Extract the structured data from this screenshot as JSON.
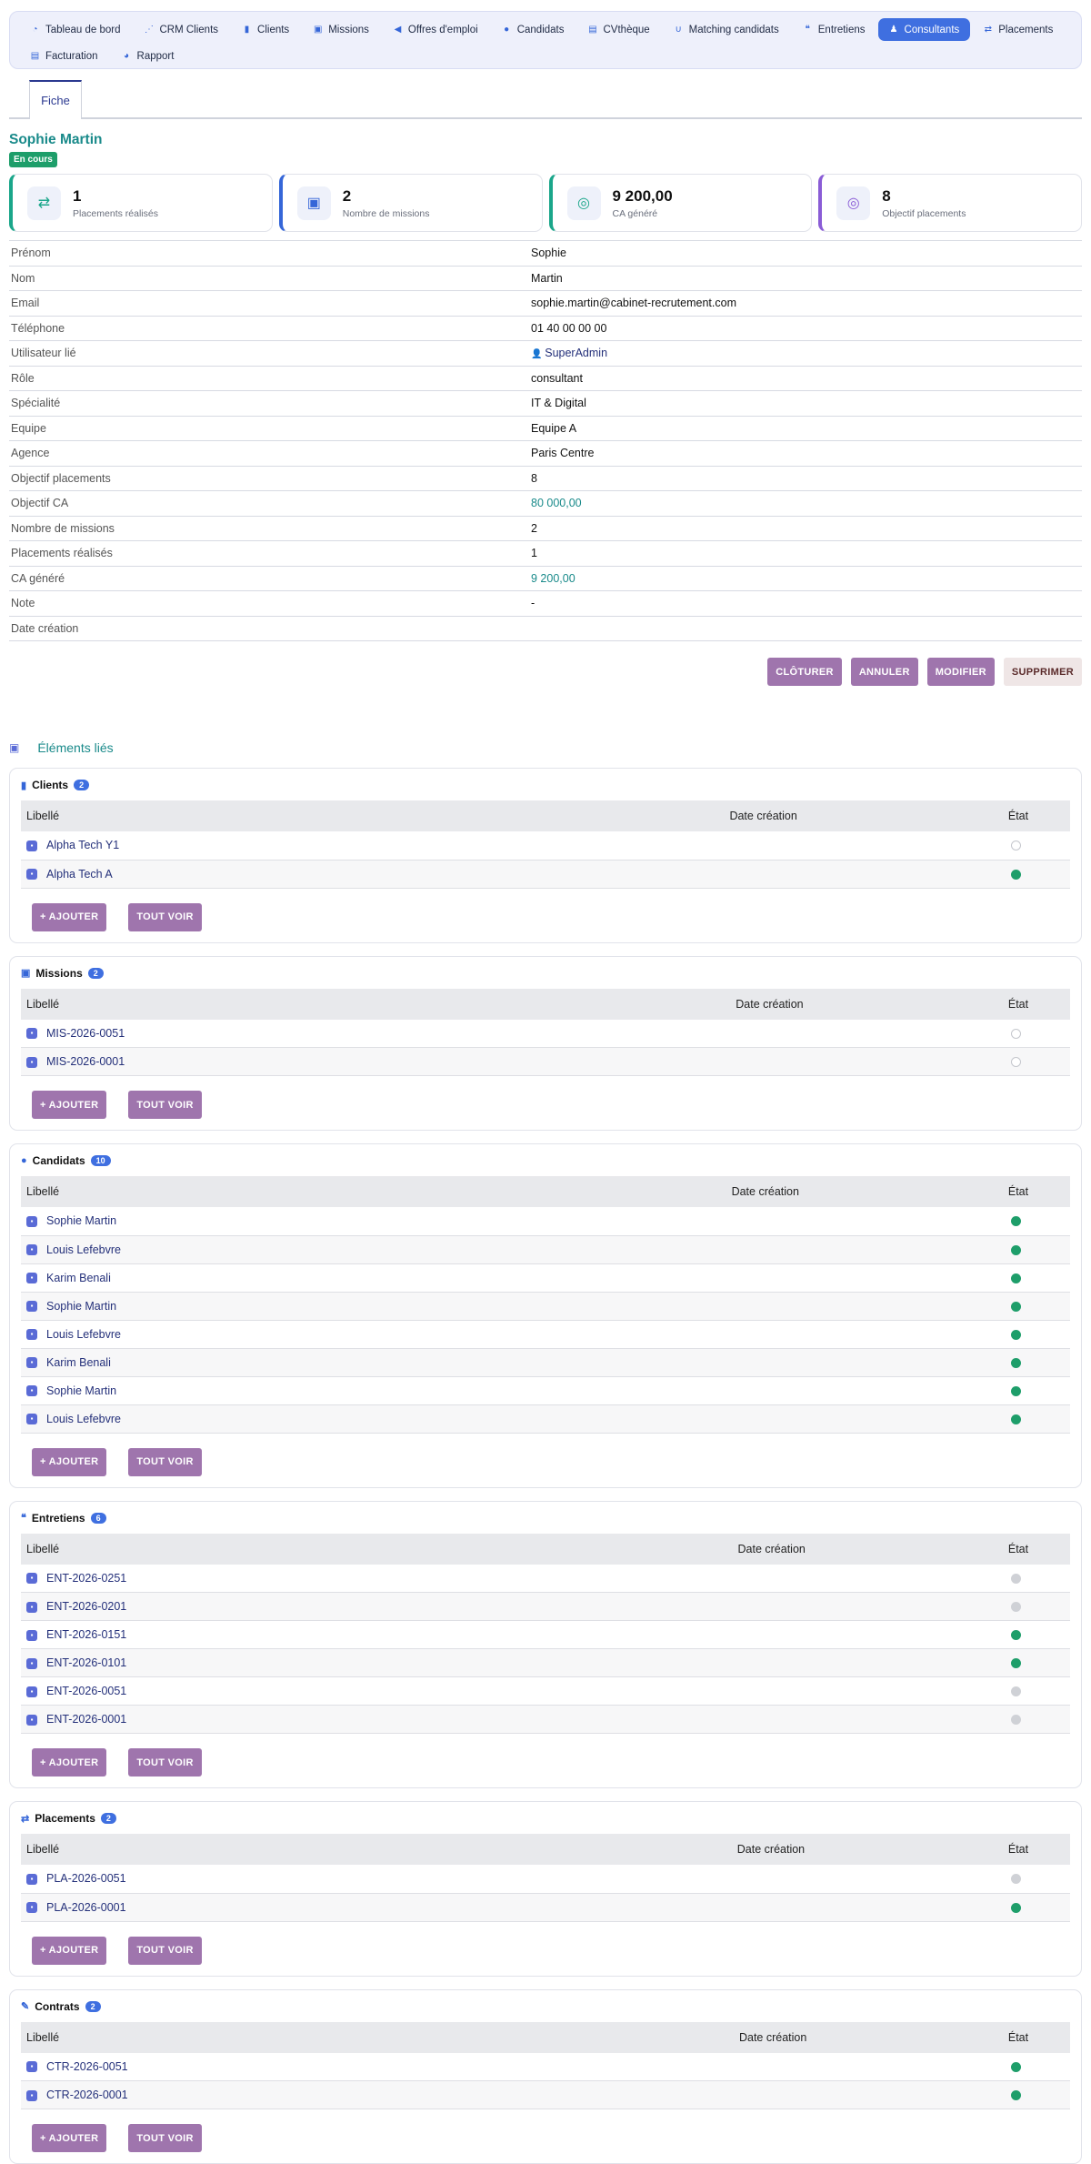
{
  "nav": [
    {
      "label": "Tableau de bord",
      "icon": "dashboard-icon",
      "glyph": "◔",
      "active": false
    },
    {
      "label": "CRM Clients",
      "icon": "network-icon",
      "glyph": "⋰",
      "active": false
    },
    {
      "label": "Clients",
      "icon": "building-icon",
      "glyph": "▮",
      "active": false
    },
    {
      "label": "Missions",
      "icon": "briefcase-icon",
      "glyph": "▣",
      "active": false
    },
    {
      "label": "Offres d'emploi",
      "icon": "megaphone-icon",
      "glyph": "◀",
      "active": false
    },
    {
      "label": "Candidats",
      "icon": "user-icon",
      "glyph": "●",
      "active": false
    },
    {
      "label": "CVthèque",
      "icon": "file-icon",
      "glyph": "▤",
      "active": false
    },
    {
      "label": "Matching candidats",
      "icon": "magnet-icon",
      "glyph": "∪",
      "active": false
    },
    {
      "label": "Entretiens",
      "icon": "comments-icon",
      "glyph": "❝",
      "active": false
    },
    {
      "label": "Consultants",
      "icon": "user-tie-icon",
      "glyph": "♟",
      "active": true
    },
    {
      "label": "Placements",
      "icon": "handshake-icon",
      "glyph": "⇄",
      "active": false
    },
    {
      "label": "Facturation",
      "icon": "invoice-icon",
      "glyph": "▤",
      "active": false
    },
    {
      "label": "Rapport",
      "icon": "pie-chart-icon",
      "glyph": "◕",
      "active": false
    }
  ],
  "tab_label": "Fiche",
  "person_name": "Sophie Martin",
  "status": "En cours",
  "kpis": [
    {
      "value": "1",
      "label": "Placements réalisés",
      "icon": "handshake-icon",
      "glyph": "⇄",
      "color": "#1aa68a"
    },
    {
      "value": "2",
      "label": "Nombre de missions",
      "icon": "briefcase-icon",
      "glyph": "▣",
      "color": "#3566d8"
    },
    {
      "value": "9 200,00",
      "label": "CA généré",
      "icon": "coins-icon",
      "glyph": "◎",
      "color": "#1aa68a"
    },
    {
      "value": "8",
      "label": "Objectif placements",
      "icon": "target-icon",
      "glyph": "◎",
      "color": "#8a5cd6"
    }
  ],
  "fields": [
    {
      "label": "Prénom",
      "value": "Sophie",
      "style": ""
    },
    {
      "label": "Nom",
      "value": "Martin",
      "style": ""
    },
    {
      "label": "Email",
      "value": "sophie.martin@cabinet-recrutement.com",
      "style": ""
    },
    {
      "label": "Téléphone",
      "value": "01 40 00 00 00",
      "style": ""
    },
    {
      "label": "Utilisateur lié",
      "value": "SuperAdmin",
      "style": "link"
    },
    {
      "label": "Rôle",
      "value": "consultant",
      "style": ""
    },
    {
      "label": "Spécialité",
      "value": "IT & Digital",
      "style": ""
    },
    {
      "label": "Equipe",
      "value": "Equipe A",
      "style": ""
    },
    {
      "label": "Agence",
      "value": "Paris Centre",
      "style": ""
    },
    {
      "label": "Objectif placements",
      "value": "8",
      "style": ""
    },
    {
      "label": "Objectif CA",
      "value": "80 000,00",
      "style": "teal"
    },
    {
      "label": "Nombre de missions",
      "value": "2",
      "style": ""
    },
    {
      "label": "Placements réalisés",
      "value": "1",
      "style": ""
    },
    {
      "label": "CA généré",
      "value": "9 200,00",
      "style": "teal"
    },
    {
      "label": "Note",
      "value": "-",
      "style": ""
    },
    {
      "label": "Date création",
      "value": "",
      "style": ""
    }
  ],
  "actions": {
    "close": "CLÔTURER",
    "cancel": "ANNULER",
    "edit": "MODIFIER",
    "delete": "SUPPRIMER"
  },
  "linked_title": "Éléments liés",
  "table_headers": {
    "label": "Libellé",
    "date": "Date création",
    "state": "État"
  },
  "card_buttons": {
    "add": "+ AJOUTER",
    "all": "TOUT VOIR"
  },
  "sections": [
    {
      "id": "clients",
      "title": "Clients",
      "count": "2",
      "icon": "building-icon",
      "glyph": "▮",
      "rows": [
        {
          "label": "Alpha Tech Y1",
          "state": "empty"
        },
        {
          "label": "Alpha Tech A",
          "state": "green"
        }
      ]
    },
    {
      "id": "missions",
      "title": "Missions",
      "count": "2",
      "icon": "briefcase-icon",
      "glyph": "▣",
      "rows": [
        {
          "label": "MIS-2026-0051",
          "state": "empty"
        },
        {
          "label": "MIS-2026-0001",
          "state": "empty"
        }
      ]
    },
    {
      "id": "candidats",
      "title": "Candidats",
      "count": "10",
      "icon": "user-icon",
      "glyph": "●",
      "rows": [
        {
          "label": "Sophie Martin",
          "state": "green"
        },
        {
          "label": "Louis Lefebvre",
          "state": "green"
        },
        {
          "label": "Karim Benali",
          "state": "green"
        },
        {
          "label": "Sophie Martin",
          "state": "green"
        },
        {
          "label": "Louis Lefebvre",
          "state": "green"
        },
        {
          "label": "Karim Benali",
          "state": "green"
        },
        {
          "label": "Sophie Martin",
          "state": "green"
        },
        {
          "label": "Louis Lefebvre",
          "state": "green"
        }
      ]
    },
    {
      "id": "entretiens",
      "title": "Entretiens",
      "count": "6",
      "icon": "comments-icon",
      "glyph": "❝",
      "rows": [
        {
          "label": "ENT-2026-0251",
          "state": "grey"
        },
        {
          "label": "ENT-2026-0201",
          "state": "grey"
        },
        {
          "label": "ENT-2026-0151",
          "state": "green"
        },
        {
          "label": "ENT-2026-0101",
          "state": "green"
        },
        {
          "label": "ENT-2026-0051",
          "state": "grey"
        },
        {
          "label": "ENT-2026-0001",
          "state": "grey"
        }
      ]
    },
    {
      "id": "placements",
      "title": "Placements",
      "count": "2",
      "icon": "handshake-icon",
      "glyph": "⇄",
      "rows": [
        {
          "label": "PLA-2026-0051",
          "state": "grey"
        },
        {
          "label": "PLA-2026-0001",
          "state": "green"
        }
      ]
    },
    {
      "id": "contrats",
      "title": "Contrats",
      "count": "2",
      "icon": "contract-icon",
      "glyph": "✎",
      "rows": [
        {
          "label": "CTR-2026-0051",
          "state": "green"
        },
        {
          "label": "CTR-2026-0001",
          "state": "green"
        }
      ]
    }
  ]
}
